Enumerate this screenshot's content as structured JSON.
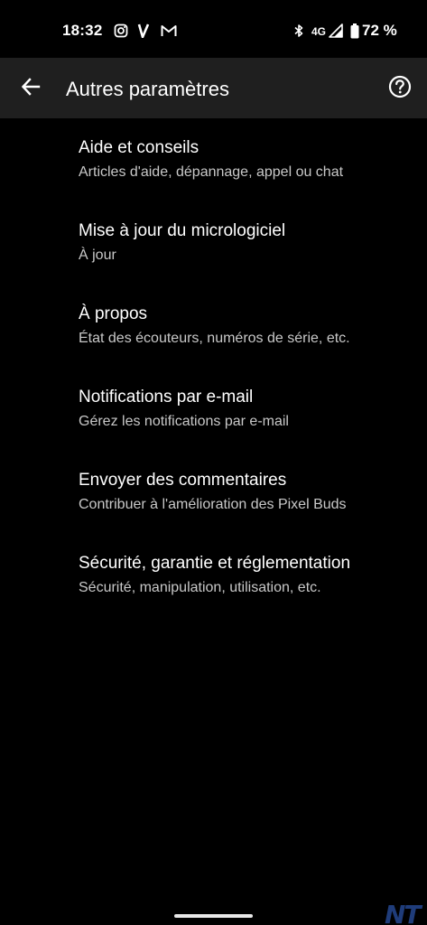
{
  "status_bar": {
    "time": "18:32",
    "network": "4G",
    "battery_pct": "72 %",
    "icons": [
      "instagram-icon",
      "v-app-icon",
      "gmail-icon",
      "bluetooth-icon",
      "signal-icon",
      "battery-icon"
    ]
  },
  "app_bar": {
    "title": "Autres paramètres",
    "back_icon": "arrow-back-icon",
    "help_icon": "help-circle-icon"
  },
  "items": [
    {
      "title": "Aide et conseils",
      "subtitle": "Articles d'aide, dépannage, appel ou chat"
    },
    {
      "title": "Mise à jour du micrologiciel",
      "subtitle": "À jour"
    },
    {
      "title": "À propos",
      "subtitle": "État des écouteurs, numéros de série, etc."
    },
    {
      "title": "Notifications par e-mail",
      "subtitle": "Gérez les notifications par e-mail"
    },
    {
      "title": "Envoyer des commentaires",
      "subtitle": "Contribuer à l'amélioration des Pixel Buds"
    },
    {
      "title": "Sécurité, garantie et réglementation",
      "subtitle": "Sécurité, manipulation, utilisation, etc."
    }
  ],
  "watermark": "NT",
  "colors": {
    "background": "#000000",
    "app_bar": "#1f1f1f",
    "title_text": "#ffffff",
    "subtitle_text": "#c8c8c8"
  }
}
